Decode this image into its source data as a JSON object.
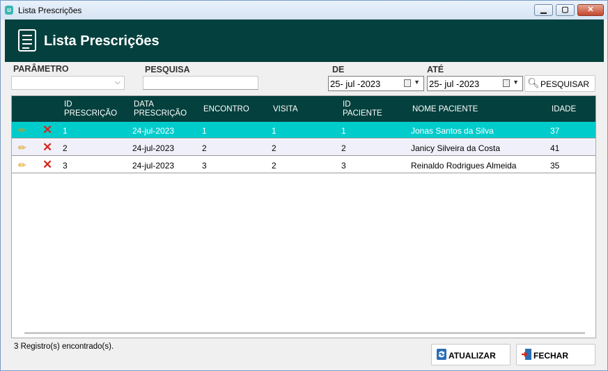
{
  "window": {
    "title": "Lista Prescrições"
  },
  "header": {
    "title": "Lista Prescrições"
  },
  "filters": {
    "parametro_label": "PARÂMETRO",
    "parametro_value": "",
    "pesquisa_label": "PESQUISA",
    "pesquisa_value": "",
    "de_label": "DE",
    "de_value": "25- jul -2023",
    "ate_label": "ATÉ",
    "ate_value": "25- jul -2023",
    "search_button": "PESQUISAR"
  },
  "table": {
    "columns": {
      "id_prescricao": "ID\nPRESCRIÇÃO",
      "data_prescricao": "DATA\nPRESCRIÇÃO",
      "encontro": "ENCONTRO",
      "visita": "VISITA",
      "id_paciente": "ID\nPACIENTE",
      "nome_paciente": "NOME PACIENTE",
      "idade": "IDADE"
    },
    "rows": [
      {
        "id": "1",
        "data": "24-jul-2023",
        "encontro": "1",
        "visita": "1",
        "id_paciente": "1",
        "nome": "Jonas Santos da Silva",
        "idade": "37"
      },
      {
        "id": "2",
        "data": "24-jul-2023",
        "encontro": "2",
        "visita": "2",
        "id_paciente": "2",
        "nome": "Janicy Silveira da Costa",
        "idade": "41"
      },
      {
        "id": "3",
        "data": "24-jul-2023",
        "encontro": "3",
        "visita": "2",
        "id_paciente": "3",
        "nome": "Reinaldo Rodrigues Almeida",
        "idade": "35"
      }
    ]
  },
  "status": {
    "count_text": "3 Registro(s) encontrado(s)."
  },
  "buttons": {
    "atualizar": "ATUALIZAR",
    "fechar": "FECHAR"
  },
  "colors": {
    "header_bg": "#04403d",
    "selected_row": "#00cccc",
    "delete_icon": "#d6281c",
    "edit_icon": "#e09a00"
  },
  "icons": {
    "edit": "pencil-icon",
    "delete": "delete-x-icon",
    "search": "magnifier-icon",
    "refresh": "refresh-icon",
    "exit": "exit-door-icon"
  }
}
